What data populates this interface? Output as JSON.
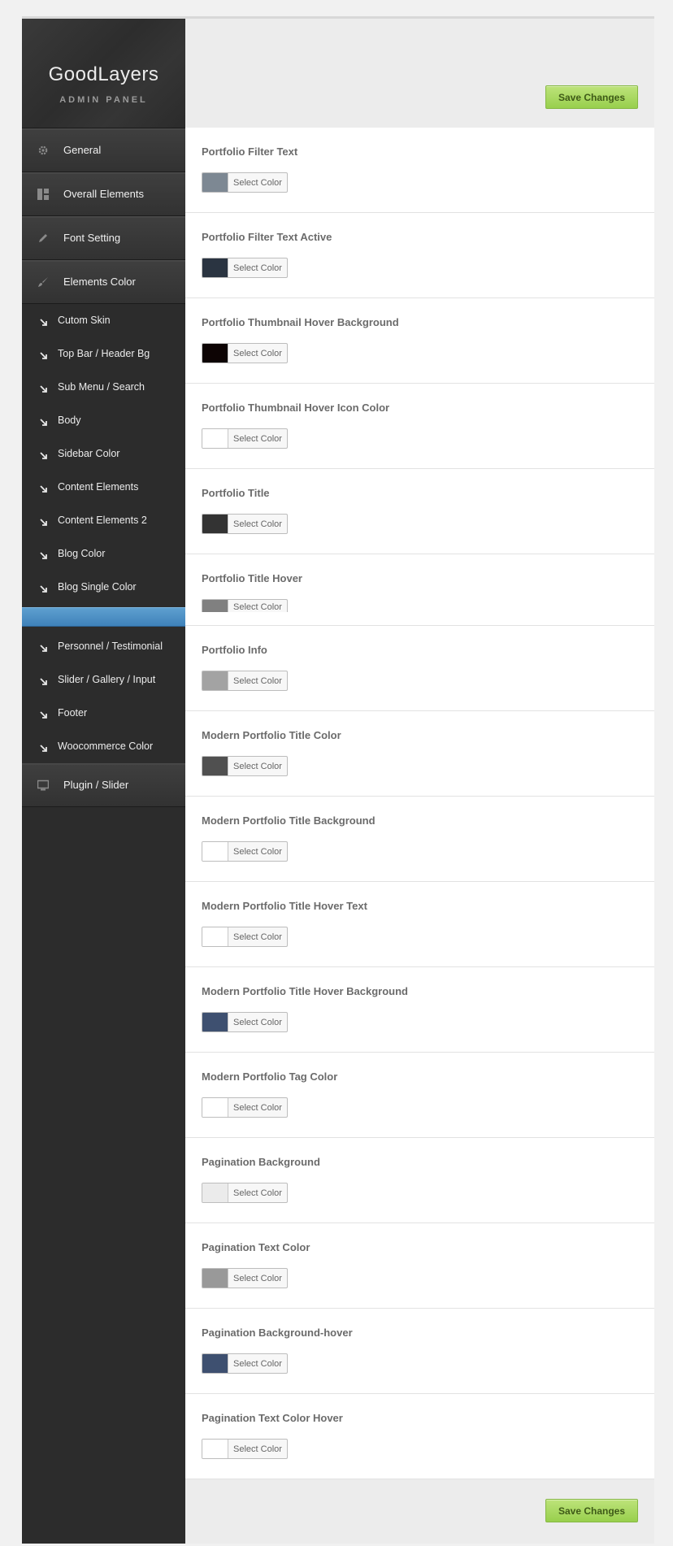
{
  "brand": {
    "title": "GoodLayers",
    "subtitle": "ADMIN PANEL"
  },
  "sidebar": {
    "main_items": [
      {
        "label": "General",
        "icon": "gear-icon"
      },
      {
        "label": "Overall Elements",
        "icon": "layout-icon"
      },
      {
        "label": "Font Setting",
        "icon": "pencil-icon"
      },
      {
        "label": "Elements Color",
        "icon": "brush-icon"
      }
    ],
    "sub_items": [
      {
        "label": "Cutom Skin"
      },
      {
        "label": "Top Bar / Header Bg"
      },
      {
        "label": "Sub Menu / Search"
      },
      {
        "label": "Body"
      },
      {
        "label": "Sidebar Color"
      },
      {
        "label": "Content Elements"
      },
      {
        "label": "Content Elements 2"
      },
      {
        "label": "Blog Color"
      },
      {
        "label": "Blog Single Color"
      },
      {
        "label": "",
        "active": true
      },
      {
        "label": "Personnel / Testimonial"
      },
      {
        "label": "Slider / Gallery / Input"
      },
      {
        "label": "Footer"
      },
      {
        "label": "Woocommerce Color"
      }
    ],
    "bottom_item": {
      "label": "Plugin / Slider",
      "icon": "monitor-icon"
    }
  },
  "save_label": "Save Changes",
  "picker_label": "Select Color",
  "options": [
    {
      "title": "Portfolio Filter Text",
      "color": "#7d8893"
    },
    {
      "title": "Portfolio Filter Text Active",
      "color": "#2a3441"
    },
    {
      "title": "Portfolio Thumbnail Hover Background",
      "color": "#0d0404"
    },
    {
      "title": "Portfolio Thumbnail Hover Icon Color",
      "color": "#ffffff"
    },
    {
      "title": "Portfolio Title",
      "color": "#333333"
    },
    {
      "title": "Portfolio Title Hover",
      "color": "#808080",
      "cut": true
    },
    {
      "title": "Portfolio Info",
      "color": "#a3a3a3"
    },
    {
      "title": "Modern Portfolio Title Color",
      "color": "#505050"
    },
    {
      "title": "Modern Portfolio Title Background",
      "color": "#ffffff"
    },
    {
      "title": "Modern Portfolio Title Hover Text",
      "color": "#ffffff"
    },
    {
      "title": "Modern Portfolio Title Hover Background",
      "color": "#3e5070"
    },
    {
      "title": "Modern Portfolio Tag Color",
      "color": "#ffffff"
    },
    {
      "title": "Pagination Background",
      "color": "#ebebeb"
    },
    {
      "title": "Pagination Text Color",
      "color": "#999999"
    },
    {
      "title": "Pagination Background-hover",
      "color": "#3e5070"
    },
    {
      "title": "Pagination Text Color Hover",
      "color": "#ffffff"
    }
  ]
}
